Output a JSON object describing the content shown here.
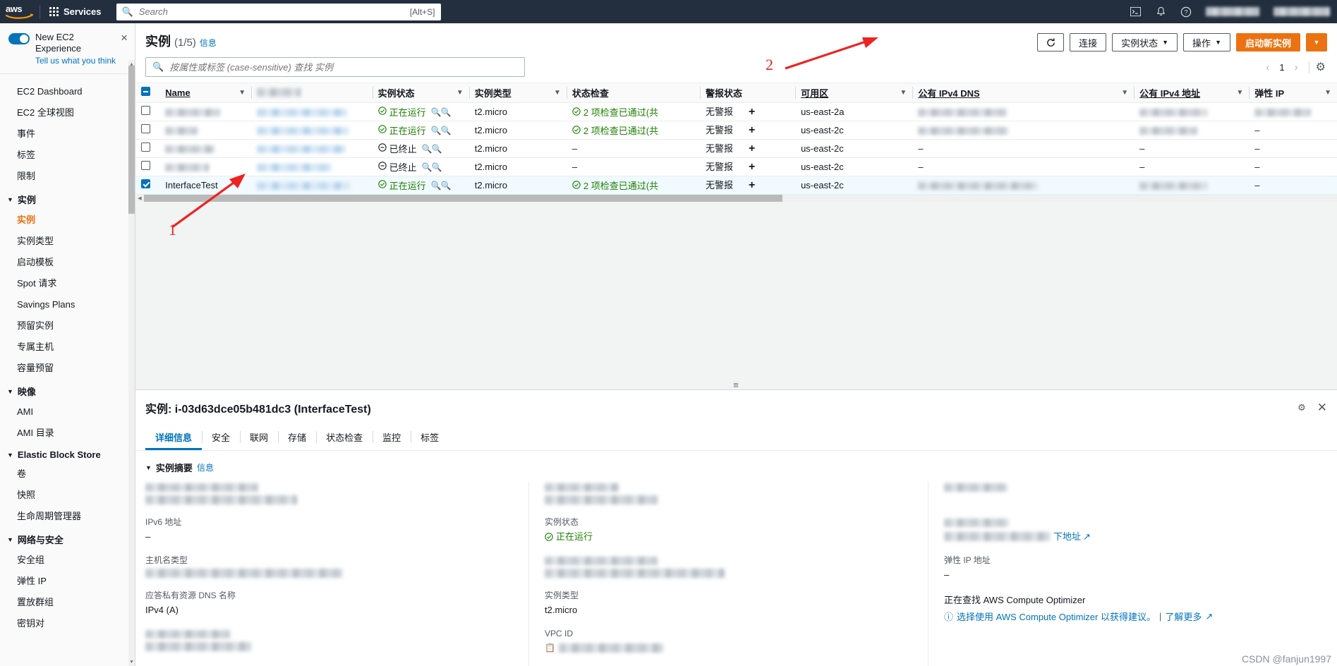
{
  "topnav": {
    "logo": "aws",
    "services_label": "Services",
    "search_placeholder": "Search",
    "search_value": "",
    "search_shortcut": "[Alt+S]",
    "icons": [
      "cloudshell-icon",
      "bell-icon",
      "help-icon"
    ]
  },
  "sidebar": {
    "promo": {
      "title": "New EC2 Experience",
      "subtitle": "Tell us what you think",
      "close": "×"
    },
    "items": [
      {
        "label": "EC2 Dashboard",
        "type": "item",
        "active": false
      },
      {
        "label": "EC2 全球视图",
        "type": "item",
        "active": false
      },
      {
        "label": "事件",
        "type": "item",
        "active": false
      },
      {
        "label": "标签",
        "type": "item",
        "active": false
      },
      {
        "label": "限制",
        "type": "item",
        "active": false
      },
      {
        "label": "实例",
        "type": "group"
      },
      {
        "label": "实例",
        "type": "item",
        "active": true
      },
      {
        "label": "实例类型",
        "type": "item",
        "active": false
      },
      {
        "label": "启动模板",
        "type": "item",
        "active": false
      },
      {
        "label": "Spot 请求",
        "type": "item",
        "active": false
      },
      {
        "label": "Savings Plans",
        "type": "item",
        "active": false
      },
      {
        "label": "预留实例",
        "type": "item",
        "active": false
      },
      {
        "label": "专属主机",
        "type": "item",
        "active": false
      },
      {
        "label": "容量预留",
        "type": "item",
        "active": false
      },
      {
        "label": "映像",
        "type": "group"
      },
      {
        "label": "AMI",
        "type": "item",
        "active": false
      },
      {
        "label": "AMI 目录",
        "type": "item",
        "active": false
      },
      {
        "label": "Elastic Block Store",
        "type": "group"
      },
      {
        "label": "卷",
        "type": "item",
        "active": false
      },
      {
        "label": "快照",
        "type": "item",
        "active": false
      },
      {
        "label": "生命周期管理器",
        "type": "item",
        "active": false
      },
      {
        "label": "网络与安全",
        "type": "group"
      },
      {
        "label": "安全组",
        "type": "item",
        "active": false
      },
      {
        "label": "弹性 IP",
        "type": "item",
        "active": false
      },
      {
        "label": "置放群组",
        "type": "item",
        "active": false
      },
      {
        "label": "密钥对",
        "type": "item",
        "active": false
      }
    ]
  },
  "list": {
    "title": "实例",
    "count": "(1/5)",
    "info_label": "信息",
    "refresh_icon": "refresh-icon",
    "connect_label": "连接",
    "instance_state_label": "实例状态",
    "actions_label": "操作",
    "launch_label": "启动新实例",
    "search_placeholder": "按属性或标签 (case-sensitive) 查找 实例",
    "search_value": "",
    "page_number": "1",
    "accent_orange": "#ec7211",
    "accent_blue": "#0073bb"
  },
  "table": {
    "columns": [
      {
        "label": "Name",
        "sortable": true
      },
      {
        "label": "实例 ID",
        "sortable": false,
        "redacted": true
      },
      {
        "label": "实例状态",
        "sortable": true
      },
      {
        "label": "实例类型",
        "sortable": true
      },
      {
        "label": "状态检查",
        "sortable": false
      },
      {
        "label": "警报状态",
        "sortable": false
      },
      {
        "label": "可用区",
        "sortable": true
      },
      {
        "label": "公有 IPv4 DNS",
        "sortable": true
      },
      {
        "label": "公有 IPv4 地址",
        "sortable": true
      },
      {
        "label": "弹性 IP",
        "sortable": true
      }
    ],
    "rows": [
      {
        "selected": false,
        "name": "",
        "name_redacted": true,
        "instance_id": "",
        "id_redacted": true,
        "state": "正在运行",
        "state_kind": "running",
        "type": "t2.micro",
        "status_check": "2 项检查已通过(共",
        "status_kind": "ok",
        "alarm": "无警报",
        "az": "us-east-2a",
        "dns": "",
        "dns_redacted": true,
        "ipv4": "",
        "ipv4_redacted": true,
        "eip": "",
        "eip_redacted": true
      },
      {
        "selected": false,
        "name": "",
        "name_redacted": true,
        "instance_id": "",
        "id_redacted": true,
        "state": "正在运行",
        "state_kind": "running",
        "type": "t2.micro",
        "status_check": "2 项检查已通过(共",
        "status_kind": "ok",
        "alarm": "无警报",
        "az": "us-east-2c",
        "dns": "",
        "dns_redacted": true,
        "ipv4": "",
        "ipv4_redacted": true,
        "eip": "–",
        "eip_redacted": false
      },
      {
        "selected": false,
        "name": "",
        "name_redacted": true,
        "instance_id": "",
        "id_redacted": true,
        "state": "已终止",
        "state_kind": "terminated",
        "type": "t2.micro",
        "status_check": "–",
        "status_kind": "none",
        "alarm": "无警报",
        "az": "us-east-2c",
        "dns": "–",
        "dns_redacted": false,
        "ipv4": "–",
        "ipv4_redacted": false,
        "eip": "–",
        "eip_redacted": false
      },
      {
        "selected": false,
        "name": "",
        "name_redacted": true,
        "instance_id": "",
        "id_redacted": true,
        "state": "已终止",
        "state_kind": "terminated",
        "type": "t2.micro",
        "status_check": "–",
        "status_kind": "none",
        "alarm": "无警报",
        "az": "us-east-2c",
        "dns": "–",
        "dns_redacted": false,
        "ipv4": "–",
        "ipv4_redacted": false,
        "eip": "–",
        "eip_redacted": false
      },
      {
        "selected": true,
        "name": "InterfaceTest",
        "name_redacted": false,
        "instance_id": "",
        "id_redacted": true,
        "state": "正在运行",
        "state_kind": "running",
        "type": "t2.micro",
        "status_check": "2 项检查已通过(共",
        "status_kind": "ok",
        "alarm": "无警报",
        "az": "us-east-2c",
        "dns": "",
        "dns_redacted": true,
        "ipv4": "",
        "ipv4_redacted": true,
        "eip": "–",
        "eip_redacted": false
      }
    ]
  },
  "detail": {
    "title": "实例: i-03d63dce05b481dc3 (InterfaceTest)",
    "settings_icon": "gear-icon",
    "close_icon": "close-icon",
    "tabs": [
      {
        "label": "详细信息",
        "active": true
      },
      {
        "label": "安全",
        "active": false
      },
      {
        "label": "联网",
        "active": false
      },
      {
        "label": "存储",
        "active": false
      },
      {
        "label": "状态检查",
        "active": false
      },
      {
        "label": "监控",
        "active": false
      },
      {
        "label": "标签",
        "active": false
      }
    ],
    "section_title": "实例摘要",
    "section_info": "信息",
    "columns": [
      {
        "fields": [
          {
            "key": "实例 ID",
            "value": "",
            "key_redacted": true,
            "value_redacted": true
          },
          {
            "key": "IPv6 地址",
            "value": "–",
            "key_redacted": false,
            "value_redacted": false
          },
          {
            "key": "主机名类型",
            "value": "",
            "key_redacted": false,
            "value_redacted": true
          },
          {
            "key": "应答私有资源 DNS 名称",
            "value": "IPv4 (A)",
            "key_redacted": false,
            "value_redacted": false
          },
          {
            "key": "自动分配的 IP 地址",
            "value": "",
            "key_redacted": true,
            "value_redacted": true
          }
        ]
      },
      {
        "fields": [
          {
            "key": "",
            "value": "",
            "key_redacted": true,
            "value_redacted": true
          },
          {
            "key": "实例状态",
            "value": "正在运行",
            "key_redacted": false,
            "value_redacted": false,
            "state": true
          },
          {
            "key": "",
            "value": "",
            "key_redacted": true,
            "value_redacted": true
          },
          {
            "key": "实例类型",
            "value": "t2.micro",
            "key_redacted": false,
            "value_redacted": false
          },
          {
            "key": "VPC ID",
            "value": "",
            "key_redacted": false,
            "value_redacted": true,
            "copy": true
          }
        ]
      },
      {
        "fields": [
          {
            "key": "",
            "value": "",
            "key_redacted": true,
            "value_redacted": true
          },
          {
            "key": "",
            "value": "下地址",
            "key_redacted": true,
            "value_redacted": true,
            "link": true
          },
          {
            "key": "弹性 IP 地址",
            "value": "–",
            "key_redacted": false,
            "value_redacted": false
          }
        ],
        "optimizer": {
          "note": "正在查找 AWS Compute Optimizer",
          "recommend": "选择使用 AWS Compute Optimizer 以获得建议。",
          "learn_more": "了解更多"
        }
      }
    ]
  },
  "annotations": {
    "marker_1": "1",
    "marker_2": "2",
    "arrow_color": "#ee2222"
  },
  "watermark": "CSDN @fanjun1997"
}
